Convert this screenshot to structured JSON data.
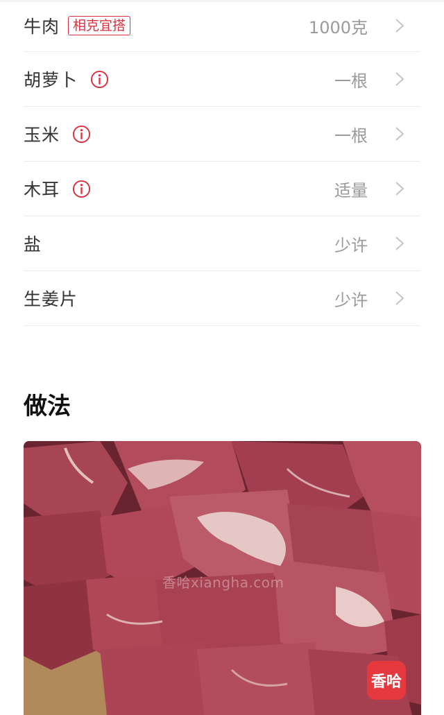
{
  "ingredients": [
    {
      "name": "牛肉",
      "tag": "相克宜搭",
      "info": false,
      "amount": "1000克"
    },
    {
      "name": "胡萝卜",
      "tag": "",
      "info": true,
      "amount": "一根"
    },
    {
      "name": "玉米",
      "tag": "",
      "info": true,
      "amount": "一根"
    },
    {
      "name": "木耳",
      "tag": "",
      "info": true,
      "amount": "适量"
    },
    {
      "name": "盐",
      "tag": "",
      "info": false,
      "amount": "少许"
    },
    {
      "name": "生姜片",
      "tag": "",
      "info": false,
      "amount": "少许"
    }
  ],
  "steps": {
    "title": "做法",
    "image": {
      "watermark": "香哈xiangha.com",
      "logo_text": "香哈"
    }
  },
  "colors": {
    "accent": "#d9313f",
    "muted_text": "#9a9a9a",
    "divider": "#ececec"
  },
  "icons": {
    "info": "info-circle-icon",
    "chevron": "chevron-right-icon"
  }
}
